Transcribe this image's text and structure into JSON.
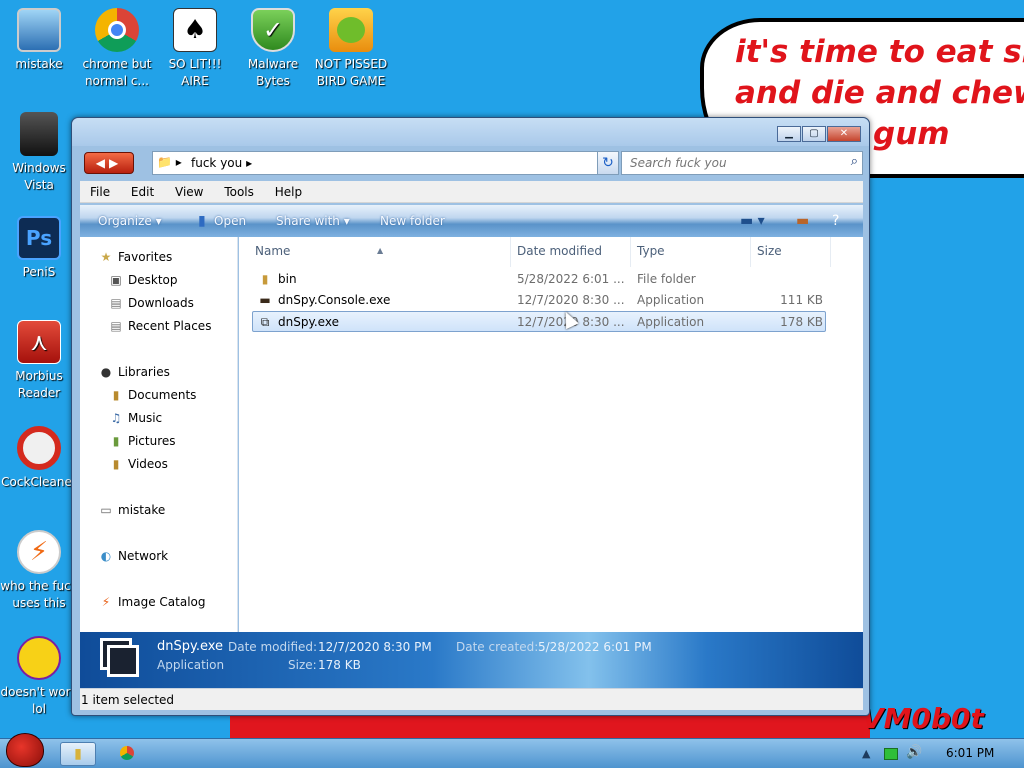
{
  "desktop": {
    "icons": [
      {
        "label": "mistake",
        "icon": "computer-icon"
      },
      {
        "label": "chrome but normal c...",
        "icon": "chrome-icon"
      },
      {
        "label": "SO LIT!!! AIRE",
        "icon": "solitaire-icon"
      },
      {
        "label": "Malware Bytes",
        "icon": "shield-icon"
      },
      {
        "label": "NOT PISSED BIRD GAME",
        "icon": "pig-icon"
      },
      {
        "label": "Windows Vista",
        "icon": "vista-icon"
      },
      {
        "label": "PeniS",
        "icon": "photoshop-icon"
      },
      {
        "label": "Morbius Reader",
        "icon": "pdf-reader-icon"
      },
      {
        "label": "CockCleaner",
        "icon": "ccleaner-icon"
      },
      {
        "label": "who the fuck uses this",
        "icon": "lightning-icon"
      },
      {
        "label": "doesn't work lol",
        "icon": "yahoo-icon"
      }
    ],
    "speech_bubble_text": "it's time to eat shit and die and chew gum",
    "speech_bubble_lines": [
      "it's time to eat shit",
      "and die and chew",
      "gum"
    ],
    "watermark": "VM0b0t",
    "colors": {
      "background": "#22a2e8",
      "accent_red": "#e0141b"
    }
  },
  "window": {
    "address_path": "fuck you",
    "search_placeholder": "Search fuck you",
    "menu": [
      "File",
      "Edit",
      "View",
      "Tools",
      "Help"
    ],
    "commands": {
      "organize": "Organize",
      "open": "Open",
      "share": "Share with",
      "new_folder": "New folder"
    },
    "nav": {
      "favorites": "Favorites",
      "desktop": "Desktop",
      "downloads": "Downloads",
      "recent": "Recent Places",
      "libraries": "Libraries",
      "documents": "Documents",
      "music": "Music",
      "pictures": "Pictures",
      "videos": "Videos",
      "computer": "mistake",
      "network": "Network",
      "image_catalog": "Image Catalog"
    },
    "columns": {
      "name": "Name",
      "date": "Date modified",
      "type": "Type",
      "size": "Size"
    },
    "files": [
      {
        "name": "bin",
        "date": "5/28/2022 6:01 ...",
        "type": "File folder",
        "size": "",
        "icon": "folder-icon"
      },
      {
        "name": "dnSpy.Console.exe",
        "date": "12/7/2020 8:30 ...",
        "type": "Application",
        "size": "111 KB",
        "icon": "console-app-icon"
      },
      {
        "name": "dnSpy.exe",
        "date": "12/7/2020 8:30 ...",
        "type": "Application",
        "size": "178 KB",
        "icon": "app-window-icon"
      }
    ],
    "selected_index": 2,
    "details": {
      "name": "dnSpy.exe",
      "type": "Application",
      "date_modified_label": "Date modified:",
      "date_modified": "12/7/2020 8:30 PM",
      "size_label": "Size:",
      "size": "178 KB",
      "date_created_label": "Date created:",
      "date_created": "5/28/2022 6:01 PM"
    },
    "status": "1 item selected"
  },
  "taskbar": {
    "clock": "6:01 PM"
  }
}
